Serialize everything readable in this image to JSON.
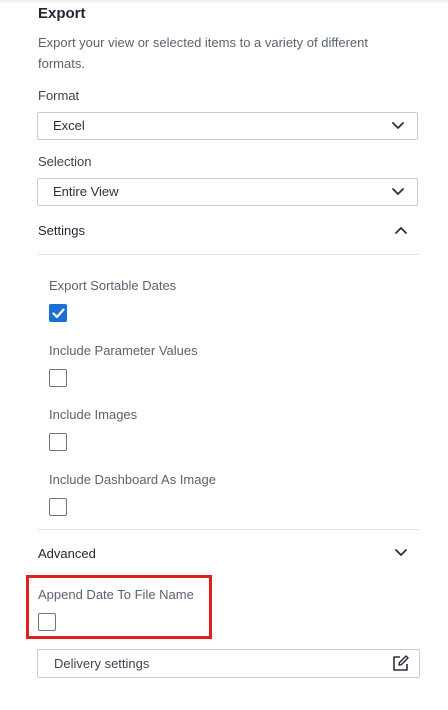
{
  "panel": {
    "title": "Export",
    "description": "Export your view or selected items to a variety of different formats."
  },
  "format": {
    "label": "Format",
    "value": "Excel"
  },
  "selection": {
    "label": "Selection",
    "value": "Entire View"
  },
  "settings": {
    "label": "Settings",
    "expanded": true,
    "options": [
      {
        "label": "Export Sortable Dates",
        "checked": true
      },
      {
        "label": "Include Parameter Values",
        "checked": false
      },
      {
        "label": "Include Images",
        "checked": false
      },
      {
        "label": "Include Dashboard As Image",
        "checked": false
      }
    ]
  },
  "advanced": {
    "label": "Advanced",
    "expanded": false,
    "append_date": {
      "label": "Append Date To File Name",
      "checked": false
    }
  },
  "delivery": {
    "label": "Delivery settings"
  },
  "colors": {
    "accent": "#1a6fd6",
    "highlight": "#e01f1f"
  },
  "icons": {
    "format_dropdown": "chevron-down-icon",
    "selection_dropdown": "chevron-down-icon",
    "settings_toggle": "chevron-up-icon",
    "advanced_toggle": "chevron-down-icon",
    "checked_mark": "checkmark-icon",
    "delivery_edit": "edit-icon"
  }
}
